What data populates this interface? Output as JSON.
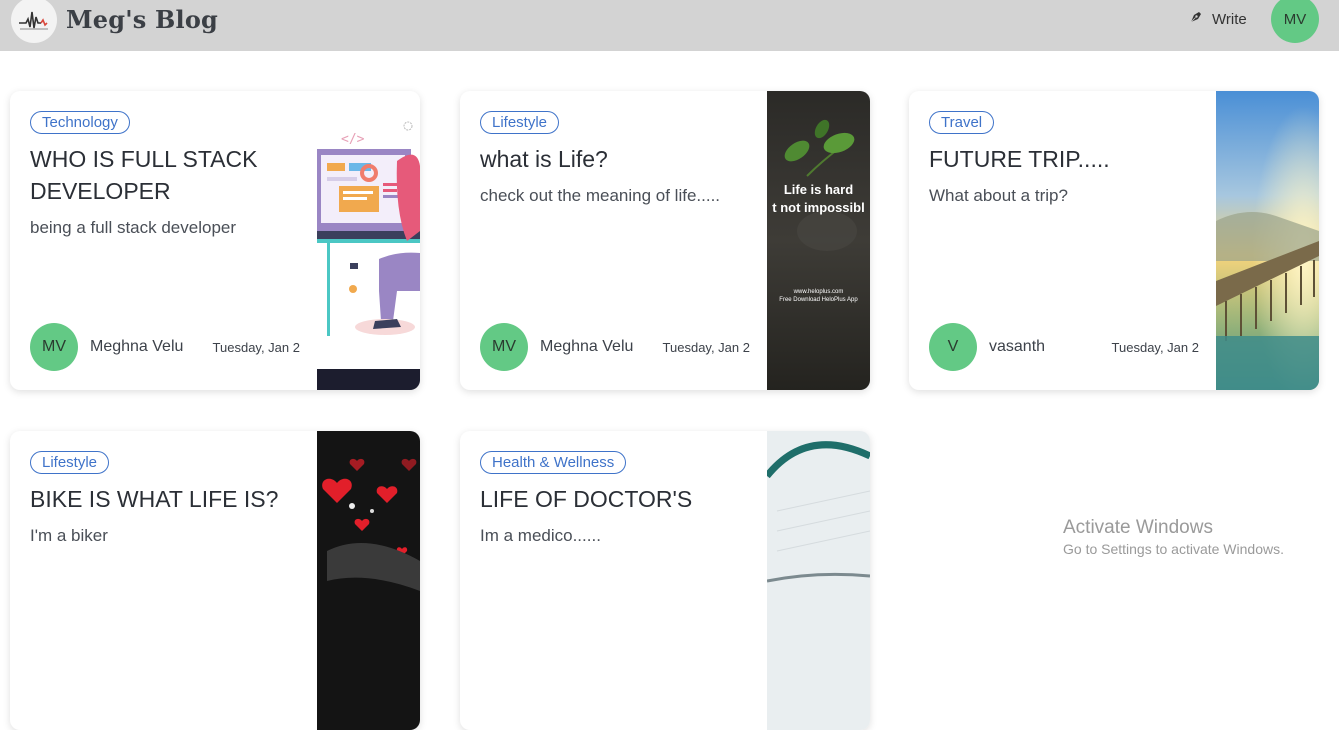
{
  "header": {
    "brand": "Meg's Blog",
    "write_label": "Write",
    "user_initials": "MV",
    "logo_icon": "pulse-logo-icon",
    "write_icon": "pen-nib-icon"
  },
  "colors": {
    "header_bg": "#d3d3d3",
    "avatar_green": "#63c985",
    "tag_blue": "#3f73c9"
  },
  "posts": [
    {
      "tag": "Technology",
      "title": "WHO IS FULL STACK DEVELOPER",
      "description": "being a full stack developer",
      "author_initials": "MV",
      "author": "Meghna Velu",
      "date": "Tuesday, Jan 2",
      "image": "developer-illustration"
    },
    {
      "tag": "Lifestyle",
      "title": "what is Life?",
      "description": "check out the meaning of life.....",
      "author_initials": "MV",
      "author": "Meghna Velu",
      "date": "Tuesday, Jan 2",
      "image": "plant-quote-image",
      "image_text": {
        "line1": "Life is hard",
        "line2": "t not impossibl",
        "line3": "www.heloplus.com",
        "line4": "Free Download HeloPlus App"
      }
    },
    {
      "tag": "Travel",
      "title": "FUTURE TRIP.....",
      "description": "What about a trip?",
      "author_initials": "V",
      "author": "vasanth",
      "date": "Tuesday, Jan 2",
      "image": "sunset-bridge-image"
    },
    {
      "tag": "Lifestyle",
      "title": "BIKE IS WHAT LIFE IS?",
      "description": "I'm a biker",
      "image": "hearts-image"
    },
    {
      "tag": "Health & Wellness",
      "title": "LIFE OF DOCTOR'S",
      "description": "Im a medico......",
      "image": "stethoscope-image"
    }
  ],
  "watermark": {
    "line1": "Activate Windows",
    "line2": "Go to Settings to activate Windows."
  }
}
